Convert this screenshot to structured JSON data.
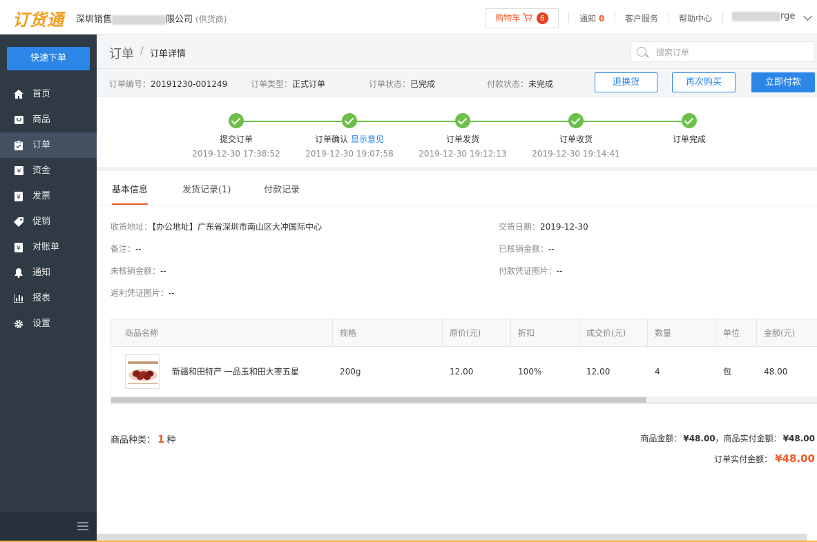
{
  "header": {
    "logo": "订货通",
    "company_prefix": "深圳销售",
    "company_suffix": "限公司",
    "company_tag": "(供货商)",
    "cart_label": "购物车",
    "cart_count": "6",
    "notice_label": "通知",
    "notice_count": "0",
    "service_label": "客户服务",
    "help_label": "帮助中心",
    "user_suffix": "rge"
  },
  "sidebar": {
    "quick_order": "快速下单",
    "items": [
      {
        "label": "首页",
        "icon": "home-icon"
      },
      {
        "label": "商品",
        "icon": "product-icon"
      },
      {
        "label": "订单",
        "icon": "order-icon",
        "active": true
      },
      {
        "label": "资金",
        "icon": "funds-icon"
      },
      {
        "label": "发票",
        "icon": "invoice-icon"
      },
      {
        "label": "促销",
        "icon": "promotion-tag-icon"
      },
      {
        "label": "对账单",
        "icon": "statement-icon"
      },
      {
        "label": "通知",
        "icon": "bell-icon"
      },
      {
        "label": "报表",
        "icon": "chart-icon"
      },
      {
        "label": "设置",
        "icon": "gear-icon"
      }
    ]
  },
  "breadcrumb": {
    "root": "订单",
    "separator": "/",
    "current": "订单详情"
  },
  "search": {
    "placeholder": "搜索订单"
  },
  "order_info": {
    "number_key": "订单编号：",
    "number": "20191230-001249",
    "type_key": "订单类型：",
    "type": "正式订单",
    "status_key": "订单状态：",
    "status": "已完成",
    "pay_status_key": "付款状态：",
    "pay_status": "未完成"
  },
  "actions": {
    "return_label": "退换货",
    "rebuy_label": "再次购买",
    "pay_label": "立即付款"
  },
  "steps": [
    {
      "label": "提交订单",
      "time": "2019-12-30 17:38:52"
    },
    {
      "label": "订单确认",
      "link": "显示意见",
      "time": "2019-12-30 19:07:58"
    },
    {
      "label": "订单发货",
      "time": "2019-12-30 19:12:13"
    },
    {
      "label": "订单收货",
      "time": "2019-12-30 19:14:41"
    },
    {
      "label": "订单完成",
      "time": ""
    }
  ],
  "tabs": [
    "基本信息",
    "发货记录(1)",
    "付款记录"
  ],
  "fields": {
    "address_key": "收货地址：",
    "address": "【办公地址】广东省深圳市南山区大冲国际中心",
    "delivery_date_key": "交货日期：",
    "delivery_date": "2019-12-30",
    "remark_key": "备注：",
    "remark": "--",
    "written_off_key": "已核销金额：",
    "written_off": "--",
    "unwritten_key": "未核销金额：",
    "unwritten": "--",
    "pay_proof_key": "付款凭证图片：",
    "pay_proof": "--",
    "rebate_proof_key": "返利凭证图片：",
    "rebate_proof": "--"
  },
  "table": {
    "headers": [
      "商品名称",
      "规格",
      "原价(元)",
      "折扣",
      "成交价(元)",
      "数量",
      "单位",
      "金额(元)"
    ],
    "rows": [
      [
        "新疆和田特产 一品玉和田大枣五星",
        "200g",
        "12.00",
        "100%",
        "12.00",
        "4",
        "包",
        "48.00"
      ]
    ]
  },
  "summary": {
    "kinds_key": "商品种类：",
    "kinds": "1",
    "kinds_unit": "种",
    "goods_amount_key": "商品金额：",
    "goods_amount": "¥48.00",
    "goods_paid_key": "，商品实付金额：",
    "goods_paid": "¥48.00",
    "order_paid_key": "订单实付金额：",
    "order_paid": "¥48.00"
  },
  "colors": {
    "accent": "#2c86e8",
    "brand_orange": "#f39c1d",
    "highlight": "#f25a29",
    "step_green": "#6cc04a",
    "sidebar_bg": "#2f3a45"
  }
}
